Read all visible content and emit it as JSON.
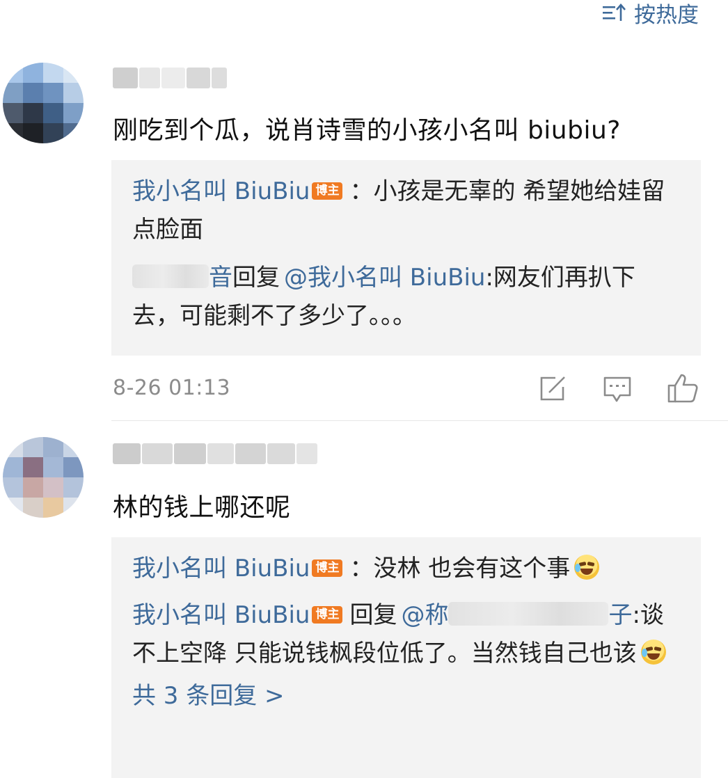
{
  "sort": {
    "label": "按热度",
    "icon": "sort-icon"
  },
  "comments": [
    {
      "author": "",
      "text": "刚吃到个瓜，说肖诗雪的小孩小名叫 biubiu?",
      "time": "8-26 01:13",
      "replies": [
        {
          "author": "我小名叫 BiuBiu",
          "badge": "博主",
          "sep": "：",
          "text": "小孩是无辜的 希望她给娃留点脸面"
        },
        {
          "author_visible": "音",
          "action": "回复",
          "mention": "@我小名叫 BiuBiu",
          "sep": ":",
          "text": "网友们再扒下去，可能剩不了多少了。。。"
        }
      ],
      "actions": [
        "share-icon",
        "comment-icon",
        "like-icon"
      ]
    },
    {
      "author": "",
      "text": "林的钱上哪还呢",
      "replies": [
        {
          "author": "我小名叫 BiuBiu",
          "badge": "博主",
          "sep": "：",
          "text": "没林 也会有这个事",
          "emoji": "laugh-cry-emoji"
        },
        {
          "author": "我小名叫 BiuBiu",
          "badge": "博主",
          "action": "回复",
          "mention_start": "@",
          "mention_visible_1": "称",
          "mention_visible_2": "子",
          "sep": ":",
          "text": "谈不上空降 只能说钱枫段位低了。当然钱自己也该",
          "emoji": "laugh-cry-emoji"
        }
      ],
      "more_replies": "共 3 条回复 >"
    }
  ],
  "colors": {
    "link": "#3e6a9a",
    "badge": "#f07a22",
    "reply_bg": "#f3f3f3",
    "meta": "#8b8b8b"
  }
}
